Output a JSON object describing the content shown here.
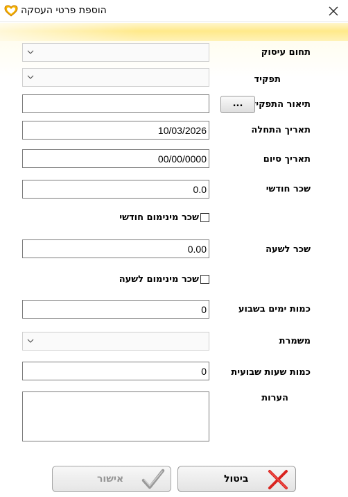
{
  "window": {
    "title": "הוספת פרטי העסקה",
    "logo_icon": "heart-logo-icon",
    "close_icon": "close-icon"
  },
  "fields": {
    "employment_domain": {
      "label": "תחום עיסוק",
      "value": ""
    },
    "role": {
      "label": "תפקיד",
      "value": ""
    },
    "role_description": {
      "label": "תיאור התפקיד",
      "value": "",
      "browse_button": "..."
    },
    "start_date": {
      "label": "תאריך התחלה",
      "value": "10/03/2026"
    },
    "end_date": {
      "label": "תאריך סיום",
      "value": "00/00/0000"
    },
    "monthly_salary": {
      "label": "שכר חודשי",
      "value": "0.0"
    },
    "min_monthly_salary": {
      "label": "שכר מינימום חודשי",
      "checked": false
    },
    "hourly_wage": {
      "label": "שכר לשעה",
      "value": "0.00"
    },
    "min_hourly_wage": {
      "label": "שכר מינימום לשעה",
      "checked": false
    },
    "days_per_week": {
      "label": "כמות ימים בשבוע",
      "value": "0"
    },
    "shift": {
      "label": "משמרת",
      "value": ""
    },
    "weekly_hours": {
      "label": "כמות שעות שבועית",
      "value": "0"
    },
    "notes": {
      "label": "הערות",
      "value": ""
    }
  },
  "buttons": {
    "cancel": {
      "label": "ביטול",
      "icon": "red-x-icon"
    },
    "approve": {
      "label": "אישור",
      "icon": "checkmark-icon",
      "disabled": true
    }
  },
  "colors": {
    "header_band": "#ffe98a",
    "cancel_icon": "#d9231f",
    "approve_icon": "#9a9a9a",
    "disabled_text": "#8a8a8a"
  }
}
